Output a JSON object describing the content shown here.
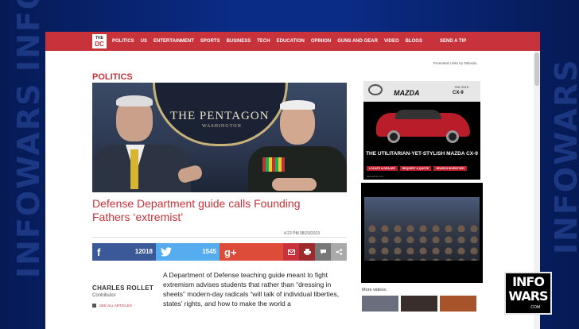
{
  "backdrop": {
    "word": "INFOWARS"
  },
  "nav": {
    "logo_the": "THE",
    "logo_dc": "DC",
    "items": [
      "POLITICS",
      "US",
      "ENTERTAINMENT",
      "SPORTS",
      "BUSINESS",
      "TECH",
      "EDUCATION",
      "OPINION",
      "GUNS AND GEAR",
      "VIDEO",
      "BLOGS"
    ],
    "tip": "SEND A TIP"
  },
  "promoted": "Promoted Links by Taboola",
  "section": "POLITICS",
  "hero": {
    "seal_text": "THE PENTAGON",
    "seal_sub": "WASHINGTON"
  },
  "article": {
    "headline": "Defense Department guide calls Founding Fathers ‘extremist’",
    "timestamp": "4:22 PM 08/23/2013",
    "author": "CHARLES ROLLET",
    "role": "Contributor",
    "all_articles": "SEE ALL ARTICLES",
    "body": "A Department of Defense teaching guide meant to fight extremism advises students that rather than “dressing in sheets” modern-day radicals “will talk of individual liberties, states’ rights, and how to make the world a"
  },
  "share": {
    "facebook_glyph": "f",
    "facebook_count": "12018",
    "twitter_count": "1545",
    "gplus_glyph": "g+"
  },
  "ad": {
    "brand": "MAZDA",
    "year": "THE 2015",
    "model": "CX-9",
    "tagline": "THE UTILITARIAN-YET-STYLISH MAZDA CX-9",
    "buttons": [
      "LOCATE A DEALER",
      "REQUEST A QUOTE",
      "SEARCH INVENTORY"
    ],
    "footer": "MazdaUSA.com"
  },
  "more_videos": "More videos:",
  "bug": {
    "line1": "INFO",
    "line2": "WARS",
    "com": ".COM"
  }
}
